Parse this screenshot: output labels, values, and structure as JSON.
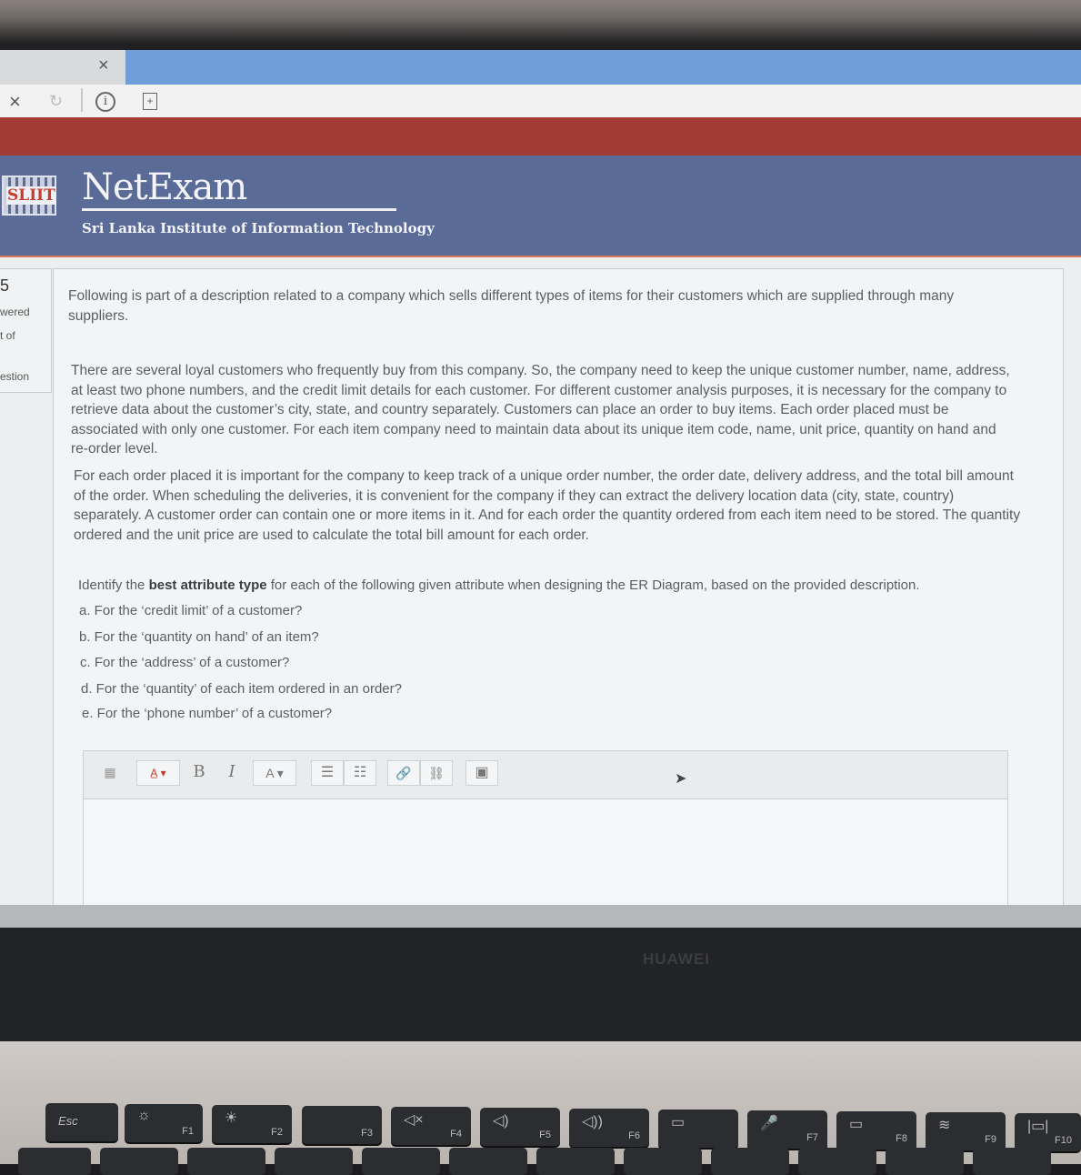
{
  "browser": {
    "close_glyph": "×",
    "stop_glyph": "×",
    "reload_glyph": "↻",
    "info_glyph": "i",
    "page_glyph": "+"
  },
  "header": {
    "logo_text": "SLIIT",
    "brand": "NetExam",
    "subtitle": "Sri Lanka Institute of Information Technology"
  },
  "leftnav": {
    "number": "5",
    "answered": "wered",
    "of": "t of",
    "question": "estion"
  },
  "question": {
    "intro": "Following is part of a description related to a company which sells different types of items for their customers which are supplied through many suppliers.",
    "para1": "There are several loyal customers who frequently buy from this company. So, the company need to keep the unique customer number, name, address, at least two phone numbers, and the credit limit details for each customer. For different customer analysis purposes, it is necessary for the company to retrieve data about the customer’s city, state, and country separately. Customers can place an order to buy items. Each order placed must be associated with only one customer. For each item company need to maintain data about its unique item code, name, unit price, quantity on hand and re-order level.",
    "para2": "For each order placed it is important for the company to keep track of a unique order number, the order date, delivery address, and the total bill amount of the order. When scheduling the deliveries, it is convenient for the company if they can extract the delivery location data (city, state, country) separately. A customer order can contain one or more items in it. And for each order the quantity ordered from each item need to be stored. The quantity ordered and the unit price are used to calculate the total bill amount for each order.",
    "prompt_pre": "Identify the ",
    "prompt_bold": "best attribute type",
    "prompt_post": " for each of the following given attribute when designing the ER Diagram, based on the provided description.",
    "items": [
      "a. For the ‘credit limit’ of a customer?",
      "b. For the ‘quantity on hand’ of an item?",
      "c. For the ‘address’ of a customer?",
      "d. For the ‘quantity’ of each item ordered in an order?",
      "e. For the ‘phone number’ of a customer?"
    ]
  },
  "editor": {
    "toolbar": {
      "font_size": "A̲ ▾",
      "bold": "B",
      "italic": "I",
      "font_color": "A ▾",
      "bullets": "☰",
      "numbers": "☷",
      "link": "🔗",
      "unlink": "⛓",
      "image": "▣"
    }
  },
  "laptop": {
    "brand": "HUAWEI",
    "keys": [
      "Esc",
      "F1",
      "F2",
      "F3",
      "F4",
      "F5",
      "F6",
      "F7",
      "F8",
      "F9",
      "F10"
    ],
    "key_icons": [
      "",
      "☼",
      "☀",
      "",
      "◁×",
      "◁)",
      "◁))",
      "▭",
      "🎤",
      "▭",
      "≋",
      "|▭|"
    ]
  }
}
